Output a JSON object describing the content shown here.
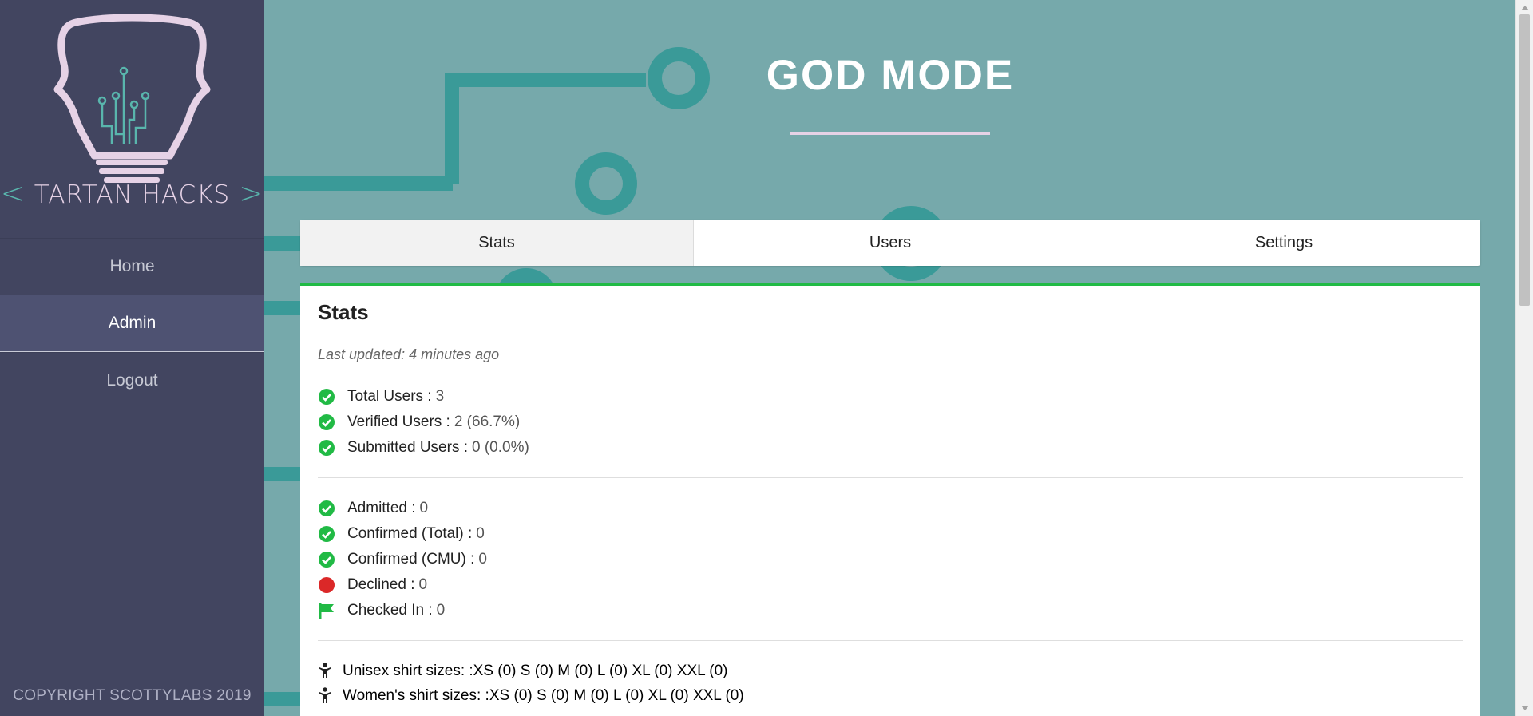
{
  "sidebar": {
    "brand": {
      "left_bracket": "<",
      "name": "TARTAN HACKS",
      "right_bracket": ">"
    },
    "nav": [
      {
        "label": "Home",
        "active": false
      },
      {
        "label": "Admin",
        "active": true
      },
      {
        "label": "Logout",
        "active": false
      }
    ],
    "copyright": "COPYRIGHT SCOTTYLABS 2019"
  },
  "header": {
    "title": "GOD MODE"
  },
  "tabs": [
    {
      "label": "Stats",
      "active": true
    },
    {
      "label": "Users",
      "active": false
    },
    {
      "label": "Settings",
      "active": false
    }
  ],
  "stats": {
    "heading": "Stats",
    "last_updated": "Last updated: 4 minutes ago",
    "user_counts": [
      {
        "icon": "check-circle-icon",
        "label": "Total Users :",
        "value": "3"
      },
      {
        "icon": "check-circle-icon",
        "label": "Verified Users :",
        "value": "2 (66.7%)"
      },
      {
        "icon": "check-circle-icon",
        "label": "Submitted Users :",
        "value": "0 (0.0%)"
      }
    ],
    "status_counts": [
      {
        "icon": "check-circle-icon",
        "label": "Admitted :",
        "value": "0"
      },
      {
        "icon": "check-circle-icon",
        "label": "Confirmed (Total) :",
        "value": "0"
      },
      {
        "icon": "check-circle-icon",
        "label": "Confirmed (CMU) :",
        "value": "0"
      },
      {
        "icon": "red-circle-icon",
        "label": "Declined :",
        "value": "0"
      },
      {
        "icon": "green-flag-icon",
        "label": "Checked In :",
        "value": "0"
      }
    ],
    "shirts": [
      {
        "icon": "child-icon",
        "label": "Unisex shirt sizes: :",
        "value": "XS (0) S (0) M (0) L (0) XL (0) XXL (0)"
      },
      {
        "icon": "child-icon",
        "label": "Women's shirt sizes: :",
        "value": "XS (0) S (0) M (0) L (0) XL (0) XXL (0)"
      }
    ]
  },
  "colors": {
    "sidebar_bg": "#424560",
    "main_bg": "#76a9ab",
    "circuit": "#3a9a98",
    "accent_pink": "#e6d2e6",
    "success_green": "#21ba45",
    "error_red": "#db2828"
  }
}
